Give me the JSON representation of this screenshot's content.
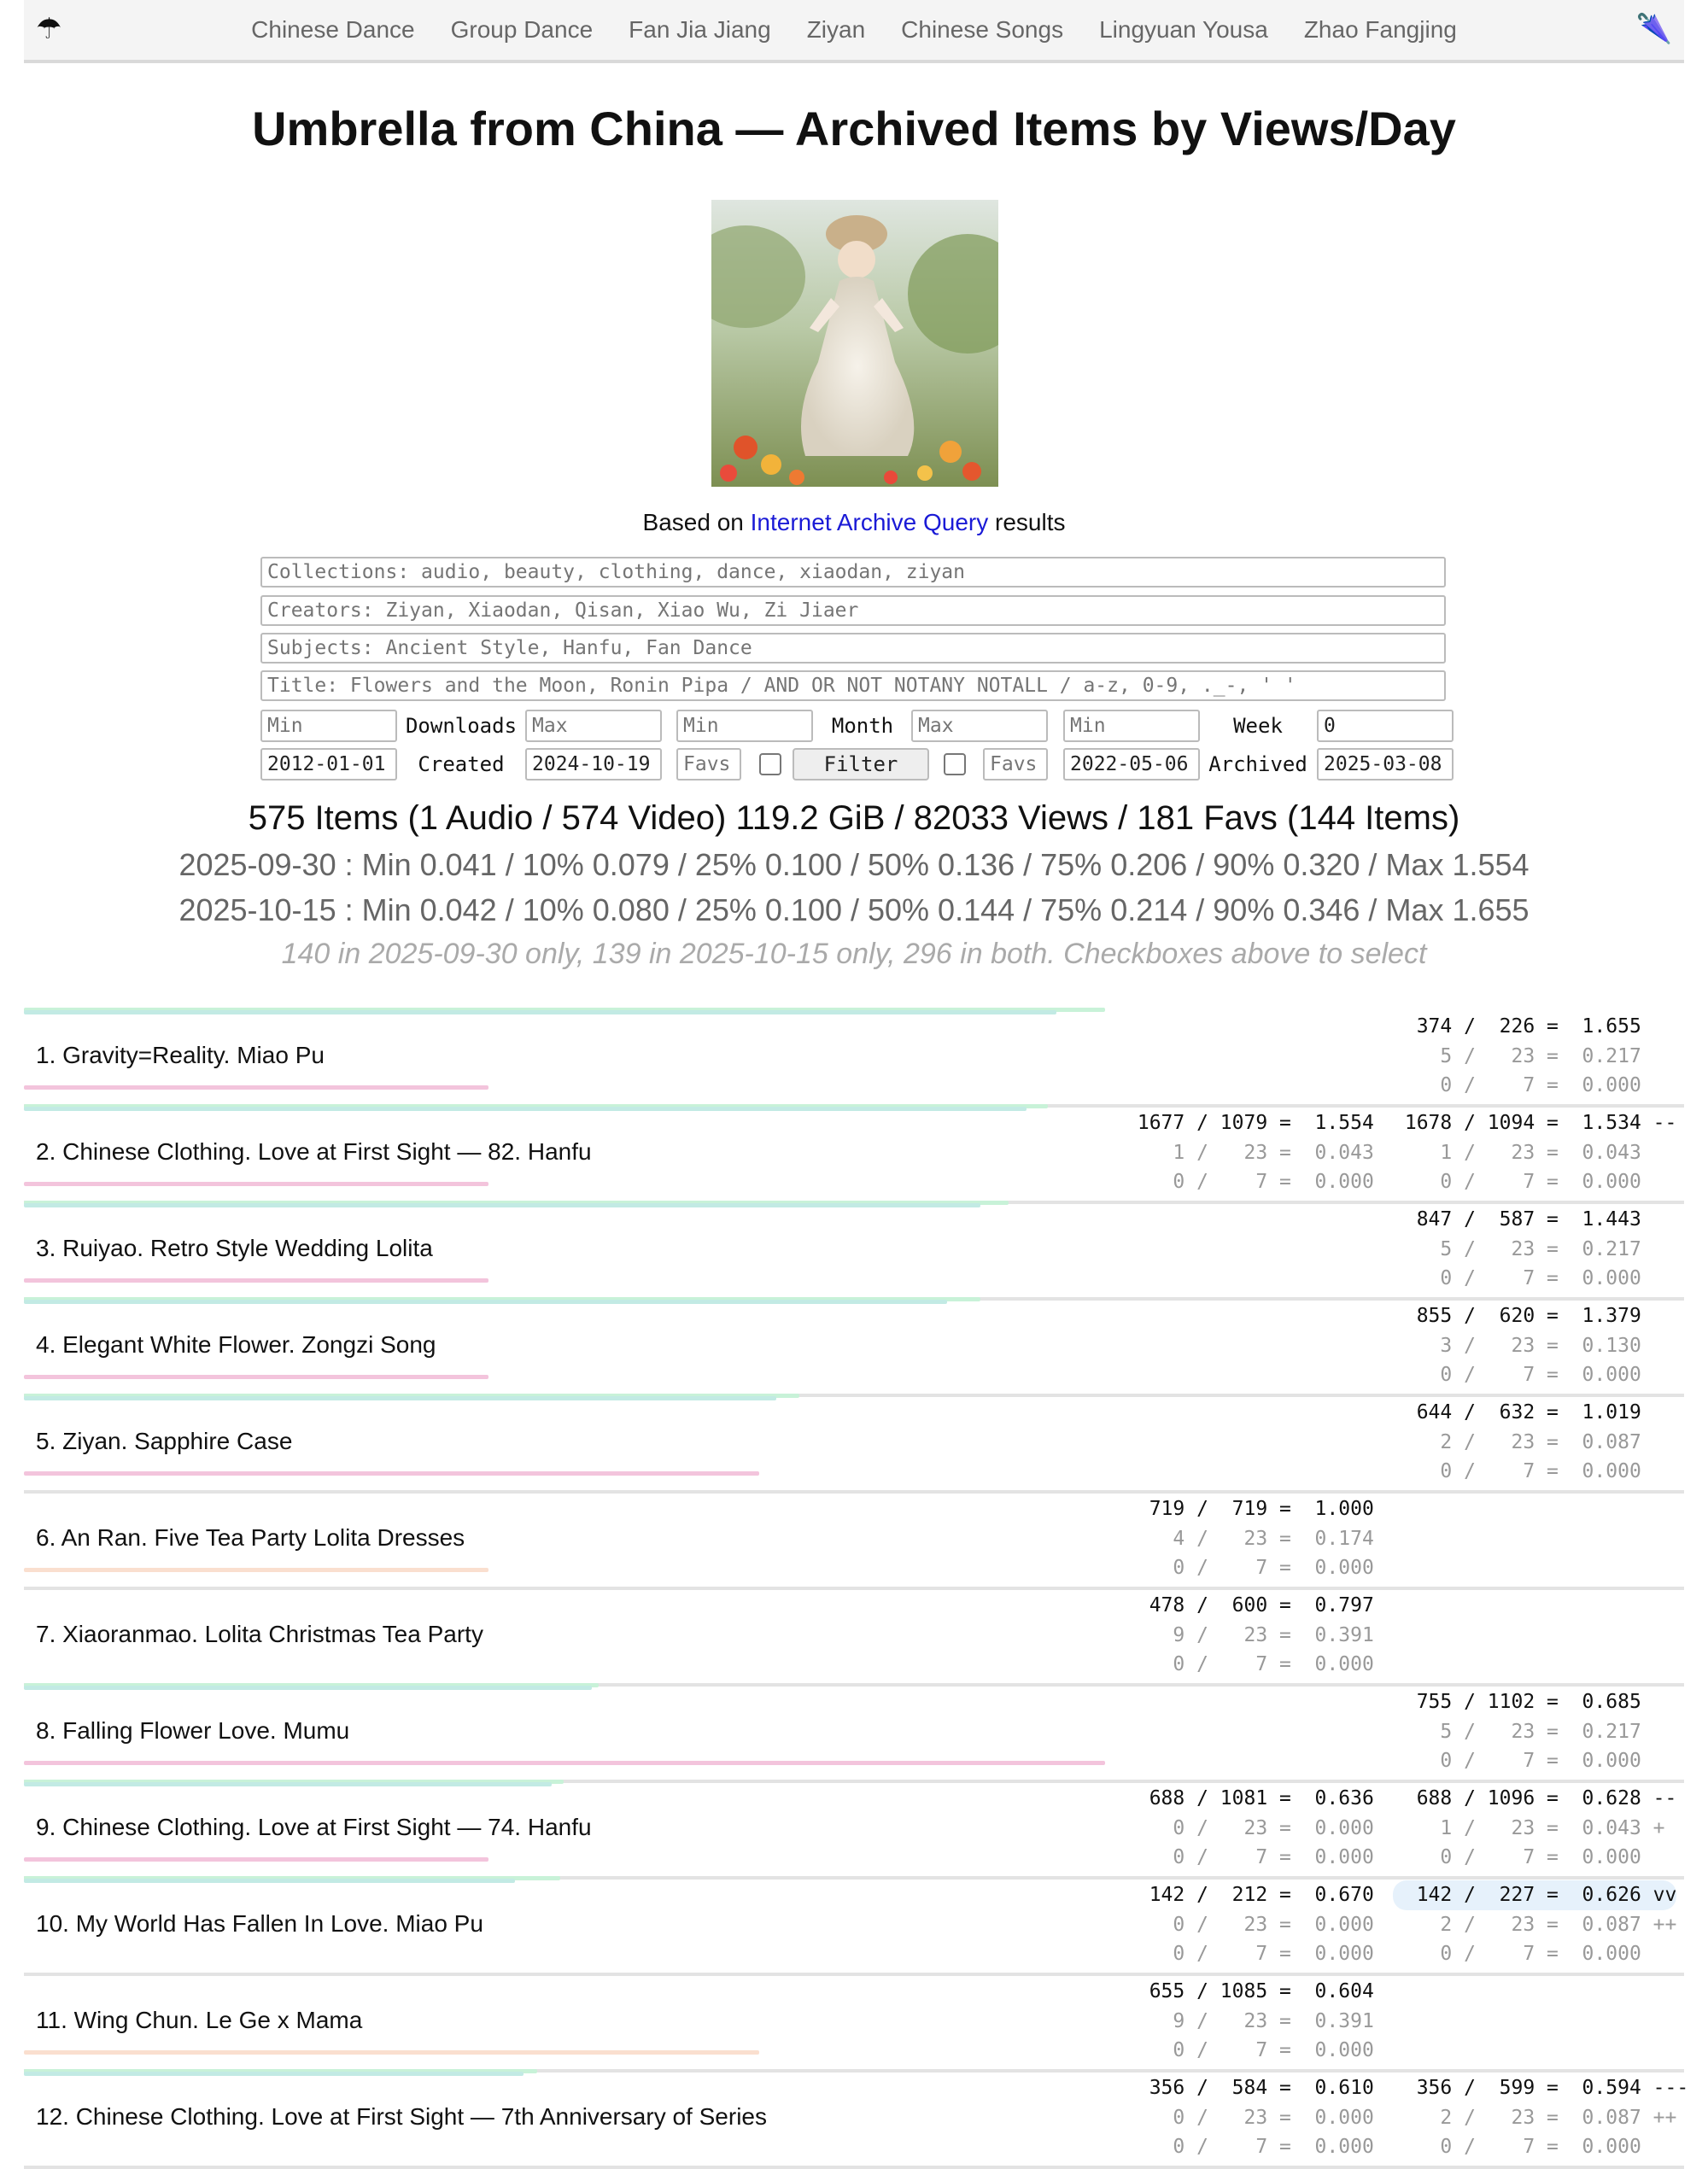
{
  "nav": {
    "logo_left": "☂",
    "logo_right": "🌂",
    "items": [
      "Chinese Dance",
      "Group Dance",
      "Fan Jia Jiang",
      "Ziyan",
      "Chinese Songs",
      "Lingyuan Yousa",
      "Zhao Fangjing"
    ]
  },
  "title": "Umbrella from China — Archived Items by Views/Day",
  "based_on": {
    "prefix": "Based on ",
    "link": "Internet Archive Query",
    "suffix": " results"
  },
  "query": {
    "collections_placeholder": "Collections: audio, beauty, clothing, dance, xiaodan, ziyan",
    "creators_placeholder": "Creators: Ziyan, Xiaodan, Qisan, Xiao Wu, Zi Jiaer",
    "subjects_placeholder": "Subjects: Ancient Style, Hanfu, Fan Dance",
    "title_placeholder": "Title: Flowers and the Moon, Ronin Pipa / AND OR NOT NOTANY NOTALL / a-z, 0-9, ._-, ' '"
  },
  "filters": {
    "downloads_min_placeholder": "Min",
    "downloads_label": "Downloads",
    "downloads_max_placeholder": "Max",
    "month_min_placeholder": "Min",
    "month_label": "Month",
    "month_max_placeholder": "Max",
    "week_min_placeholder": "Min",
    "week_label": "Week",
    "week_max_value": "0",
    "created_from": "2012-01-01",
    "created_label": "Created",
    "created_to": "2024-10-19",
    "favs_left_placeholder": "Favs",
    "filter_label": "Filter",
    "favs_right_placeholder": "Favs",
    "archived_from": "2022-05-06",
    "archived_label": "Archived",
    "archived_to": "2025-03-08"
  },
  "summary": "575 Items (1 Audio / 574 Video) 119.2 GiB / 82033 Views / 181 Favs (144 Items)",
  "quantiles": [
    "2025-09-30 : Min 0.041 / 10% 0.079 / 25% 0.100 / 50% 0.136 / 75% 0.206 / 90% 0.320 / Max 1.554",
    "2025-10-15 : Min 0.042 / 10% 0.080 / 25% 0.100 / 50% 0.144 / 75% 0.214 / 90% 0.346 / Max 1.655"
  ],
  "note": "140 in 2025-09-30 only, 139 in 2025-10-15 only, 296 in both. Checkboxes above to select",
  "colors": {
    "bar_top": "#c2eae4",
    "bar_top_alt": "#c8f2d8",
    "bar_pink": "#f3c4dc",
    "bar_peach": "#fadfcf",
    "highlight": "#e6f1fb",
    "link": "#1a1ad6"
  },
  "items": [
    {
      "title": "1. Gravity=Reality. Miao Pu",
      "bar_a": 0.622,
      "bar_b": 0.651,
      "bar_bottom": 0.28,
      "bottom_color": "pink",
      "left": null,
      "right": [
        "  374 /  226 =  1.655",
        "    5 /   23 =  0.217",
        "    0 /    7 =  0.000"
      ]
    },
    {
      "title": "2. Chinese Clothing. Love at First Sight — 82. Hanfu",
      "bar_a": 0.604,
      "bar_b": 0.617,
      "bar_bottom": 0.28,
      "bottom_color": "pink",
      "left": [
        " 1677 / 1079 =  1.554",
        "    1 /   23 =  0.043",
        "    0 /    7 =  0.000"
      ],
      "right": [
        " 1678 / 1094 =  1.534 --",
        "    1 /   23 =  0.043",
        "    0 /    7 =  0.000"
      ]
    },
    {
      "title": "3. Ruiyao. Retro Style Wedding Lolita",
      "bar_a": 0.576,
      "bar_b": 0.593,
      "bar_bottom": 0.28,
      "bottom_color": "pink",
      "left": null,
      "right": [
        "  847 /  587 =  1.443",
        "    5 /   23 =  0.217",
        "    0 /    7 =  0.000"
      ]
    },
    {
      "title": "4. Elegant White Flower. Zongzi Song",
      "bar_a": 0.556,
      "bar_b": 0.576,
      "bar_bottom": 0.28,
      "bottom_color": "pink",
      "left": null,
      "right": [
        "  855 /  620 =  1.379",
        "    3 /   23 =  0.130",
        "    0 /    7 =  0.000"
      ]
    },
    {
      "title": "5. Ziyan. Sapphire Case",
      "bar_a": 0.453,
      "bar_b": 0.467,
      "bar_bottom": 0.443,
      "bottom_color": "pink",
      "left": null,
      "right": [
        "  644 /  632 =  1.019",
        "    2 /   23 =  0.087",
        "    0 /    7 =  0.000"
      ]
    },
    {
      "title": "6. An Ran. Five Tea Party Lolita Dresses",
      "bar_a": 0,
      "bar_b": 0,
      "bar_bottom": 0.28,
      "bottom_color": "peach",
      "left": [
        "  719 /  719 =  1.000",
        "    4 /   23 =  0.174",
        "    0 /    7 =  0.000"
      ],
      "right": null
    },
    {
      "title": "7. Xiaoranmao. Lolita Christmas Tea Party",
      "bar_a": 0,
      "bar_b": 0,
      "bar_bottom": 0,
      "bottom_color": "peach",
      "left": [
        "  478 /  600 =  0.797",
        "    9 /   23 =  0.391",
        "    0 /    7 =  0.000"
      ],
      "right": null
    },
    {
      "title": "8. Falling Flower Love. Mumu",
      "bar_a": 0.342,
      "bar_b": 0.346,
      "bar_bottom": 0.651,
      "bottom_color": "pink",
      "left": null,
      "right": [
        "  755 / 1102 =  0.685",
        "    5 /   23 =  0.217",
        "    0 /    7 =  0.000"
      ]
    },
    {
      "title": "9. Chinese Clothing. Love at First Sight — 74. Hanfu",
      "bar_a": 0.318,
      "bar_b": 0.325,
      "bar_bottom": 0.28,
      "bottom_color": "pink",
      "left": [
        "  688 / 1081 =  0.636",
        "    0 /   23 =  0.000",
        "    0 /    7 =  0.000"
      ],
      "right": [
        "  688 / 1096 =  0.628 --",
        "    1 /   23 =  0.043 +",
        "    0 /    7 =  0.000"
      ]
    },
    {
      "title": "10. My World Has Fallen In Love. Miao Pu",
      "bar_a": 0.296,
      "bar_b": 0.323,
      "bar_bottom": 0,
      "bottom_color": "pink",
      "highlight": true,
      "left": [
        "  142 /  212 =  0.670",
        "    0 /   23 =  0.000",
        "    0 /    7 =  0.000"
      ],
      "right": [
        "  142 /  227 =  0.626 vv",
        "    2 /   23 =  0.087 ++",
        "    0 /    7 =  0.000"
      ]
    },
    {
      "title": "11. Wing Chun. Le Ge x Mama",
      "bar_a": 0,
      "bar_b": 0,
      "bar_bottom": 0.443,
      "bottom_color": "peach",
      "left": [
        "  655 / 1085 =  0.604",
        "    9 /   23 =  0.391",
        "    0 /    7 =  0.000"
      ],
      "right": null
    },
    {
      "title": "12. Chinese Clothing. Love at First Sight — 7th Anniversary of Series",
      "bar_a": 0.301,
      "bar_b": 0.309,
      "bar_bottom": 0,
      "bottom_color": "pink",
      "left": [
        "  356 /  584 =  0.610",
        "    0 /   23 =  0.000",
        "    0 /    7 =  0.000"
      ],
      "right": [
        "  356 /  599 =  0.594 ---",
        "    2 /   23 =  0.087 ++",
        "    0 /    7 =  0.000"
      ]
    }
  ]
}
